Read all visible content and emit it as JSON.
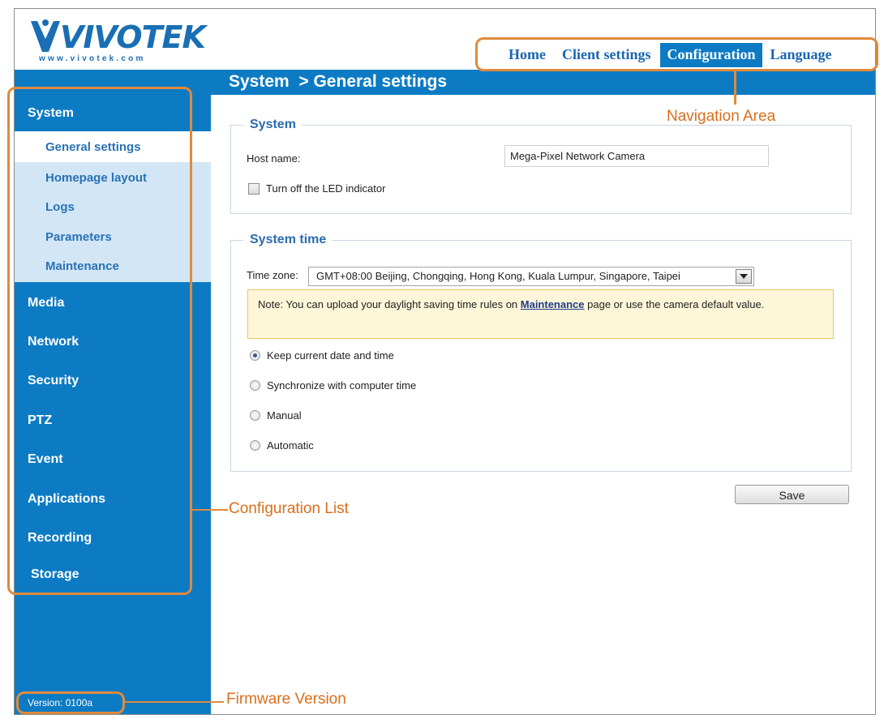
{
  "logo": {
    "name": "VIVOTEK",
    "url": "www.vivotek.com",
    "brand_color": "#1a6fb4"
  },
  "nav": {
    "items": [
      "Home",
      "Client settings",
      "Configuration",
      "Language"
    ],
    "active": "Configuration"
  },
  "breadcrumb": "System  > General settings",
  "sidebar": {
    "group_system": "System",
    "subitems": [
      "General settings",
      "Homepage layout",
      "Logs",
      "Parameters",
      "Maintenance"
    ],
    "groups": [
      "Media",
      "Network",
      "Security",
      "PTZ",
      "Event",
      "Applications",
      "Recording",
      "Storage"
    ],
    "version": "Version: 0100a"
  },
  "system_section": {
    "legend": "System",
    "host_label": "Host name:",
    "host_value": "Mega-Pixel Network Camera",
    "led_label": "Turn off the LED indicator",
    "led_checked": false
  },
  "time_section": {
    "legend": "System time",
    "tz_label": "Time zone:",
    "tz_value": "GMT+08:00 Beijing, Chongqing, Hong Kong, Kuala Lumpur, Singapore, Taipei",
    "note_prefix": "Note: You can upload your daylight saving time rules on ",
    "note_link": "Maintenance",
    "note_suffix": " page or use the camera default value.",
    "options": [
      "Keep current date and time",
      "Synchronize with computer time",
      "Manual",
      "Automatic"
    ],
    "selected": "Keep current date and time"
  },
  "save_label": "Save",
  "annotations": {
    "navigation_area": "Navigation Area",
    "configuration_list": "Configuration List",
    "firmware_version": "Firmware Version",
    "color": "#e08a3c"
  },
  "colors": {
    "blue": "#0c7bc4",
    "submenu_bg": "#d3e6f6",
    "note_bg": "#fdf6d8"
  }
}
